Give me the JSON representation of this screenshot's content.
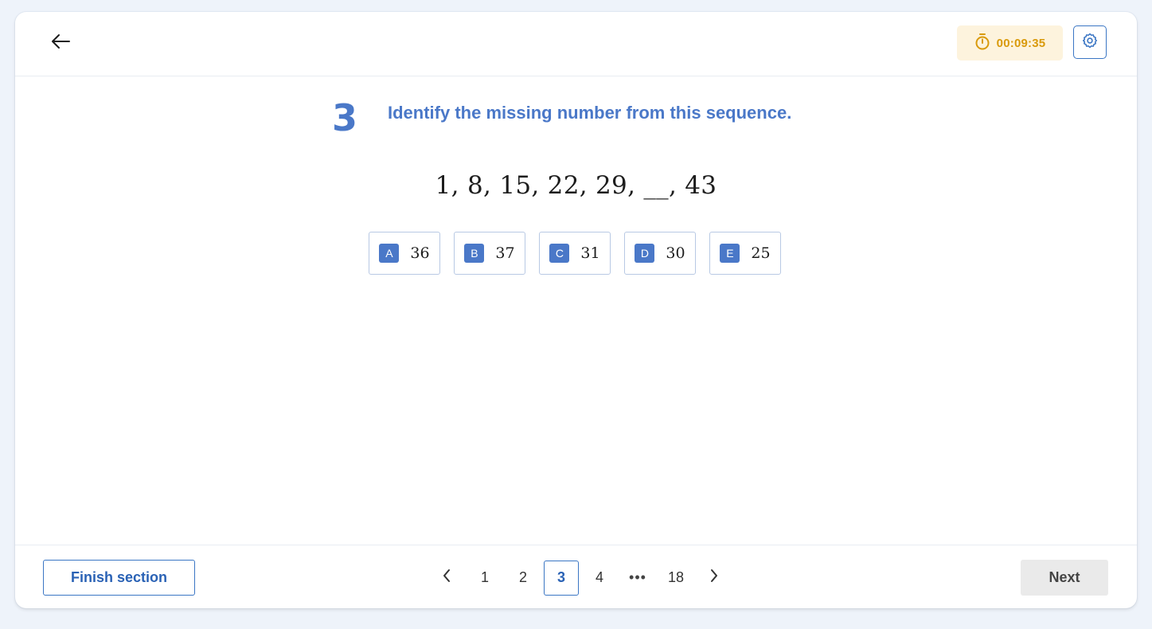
{
  "header": {
    "timer": "00:09:35",
    "colors": {
      "timer_bg": "#fdf3dd",
      "timer_text": "#d99a0b",
      "accent": "#4a78c8"
    }
  },
  "question": {
    "number": "3",
    "text": "Identify the missing number from this sequence.",
    "sequence": "1, 8, 15, 22, 29, __, 43",
    "options": [
      {
        "letter": "A",
        "value": "36"
      },
      {
        "letter": "B",
        "value": "37"
      },
      {
        "letter": "C",
        "value": "31"
      },
      {
        "letter": "D",
        "value": "30"
      },
      {
        "letter": "E",
        "value": "25"
      }
    ]
  },
  "footer": {
    "finish_label": "Finish section",
    "next_label": "Next",
    "pages": [
      "1",
      "2",
      "3",
      "4",
      "•••",
      "18"
    ],
    "current_page": "3"
  }
}
